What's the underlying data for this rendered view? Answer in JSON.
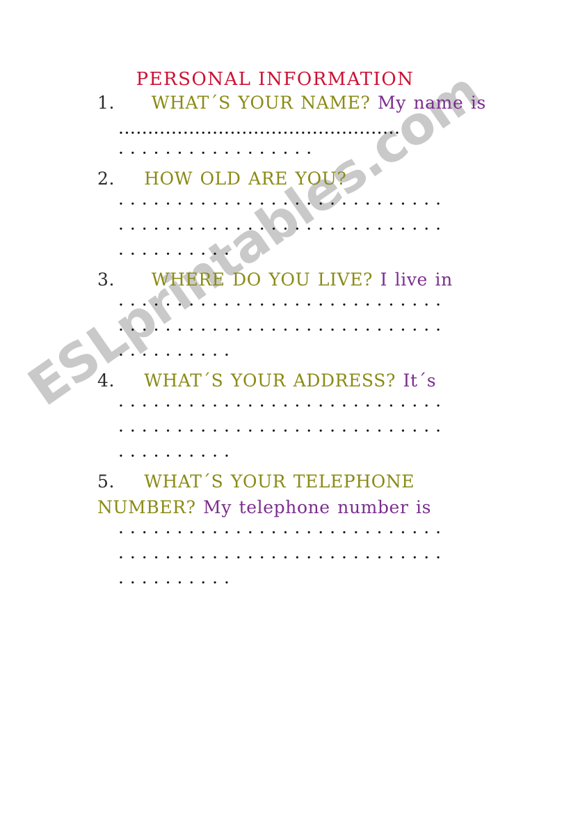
{
  "document": {
    "title": "PERSONAL INFORMATION",
    "title_color": "#cc1133",
    "question_color": "#8a8a16",
    "answer_color": "#7b2d8e",
    "number_color": "#2a2a2a",
    "dot_color": "#141414",
    "background_color": "#ffffff"
  },
  "watermark": {
    "text": "ESLprintables.com",
    "color": "#c9c9c9"
  },
  "questions": [
    {
      "number": "1.",
      "question": "WHAT´S YOUR NAME?",
      "answer_start": "My name is",
      "answer_line1": "My",
      "answer_line2": "name is",
      "dot_lines": [
        "................................................",
        "· · · · · · · · · · · · · · · · ·"
      ]
    },
    {
      "number": "2.",
      "question": "HOW OLD ARE YOU?",
      "answer_start": "",
      "dot_lines": [
        "· · · · · · · · · · · · · · · · · · · · · · · · · · · ·",
        "· · · · · · · · · · · · · · · · · · · · · · · · · · · ·",
        "· · · · · · · · · ·"
      ]
    },
    {
      "number": "3.",
      "question": "WHERE DO YOU LIVE?",
      "answer_start": "I live in",
      "answer_line1": "I",
      "answer_line2": "live in",
      "dot_lines": [
        "· · · · · · · · · · · · · · · · · · · · · · · · · · · ·",
        "· · · · · · · · · · · · · · · · · · · · · · · · · · · ·",
        "· · · · · · · · · ·"
      ]
    },
    {
      "number": "4.",
      "question": "WHAT´S YOUR ADDRESS?",
      "answer_start": "It´s",
      "answer_line1": "It",
      "answer_line2": "´s",
      "dot_lines": [
        "· · · · · · · · · · · · · · · · · · · · · · · · · · · ·",
        "· · · · · · · · · · · · · · · · · · · · · · · · · · · ·",
        "· · · · · · · · · ·"
      ]
    },
    {
      "number": "5.",
      "question_line1": "WHAT´S YOUR TELEPHONE",
      "question_line2": "NUMBER?",
      "question": "WHAT´S YOUR TELEPHONE NUMBER?",
      "answer_start": "My telephone number is",
      "answer_line1": "My telephone number",
      "answer_line2": "is",
      "dot_lines": [
        "· · · · · · · · · · · · · · · · · · · · · · · · · · · ·",
        "· · · · · · · · · · · · · · · · · · · · · · · · · · · ·",
        "· · · · · · · · · ·"
      ]
    }
  ]
}
